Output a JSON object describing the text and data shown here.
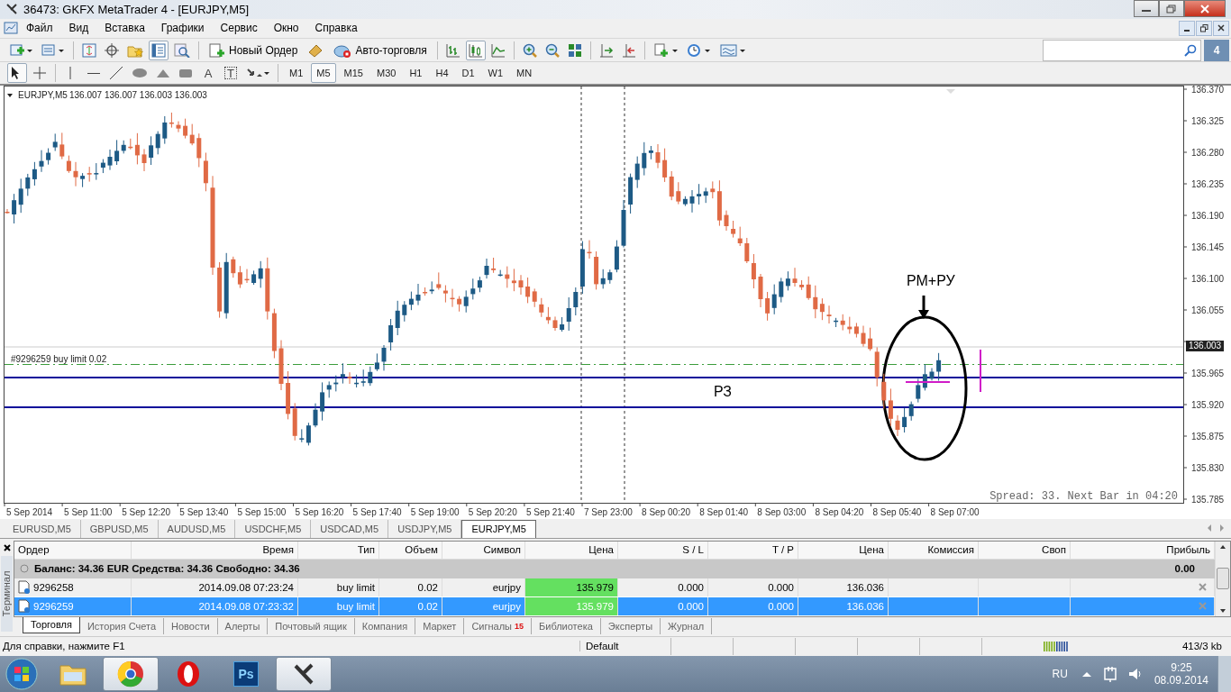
{
  "window": {
    "title": "36473: GKFX MetaTrader 4 - [EURJPY,M5]"
  },
  "menu": [
    "Файл",
    "Вид",
    "Вставка",
    "Графики",
    "Сервис",
    "Окно",
    "Справка"
  ],
  "toolbar": {
    "new_order": "Новый Ордер",
    "auto_trading": "Авто-торговля",
    "chart_types": [
      {
        "selected": false
      },
      {
        "selected": true
      },
      {
        "selected": false
      }
    ],
    "messages_badge": "4"
  },
  "drawing_tools": {
    "text_tool": "A",
    "label_tool": "T"
  },
  "timeframes": [
    {
      "label": "M1",
      "selected": false
    },
    {
      "label": "M5",
      "selected": true
    },
    {
      "label": "M15",
      "selected": false
    },
    {
      "label": "M30",
      "selected": false
    },
    {
      "label": "H1",
      "selected": false
    },
    {
      "label": "H4",
      "selected": false
    },
    {
      "label": "D1",
      "selected": false
    },
    {
      "label": "W1",
      "selected": false
    },
    {
      "label": "MN",
      "selected": false
    }
  ],
  "chart": {
    "symbol": "EURJPY,M5",
    "ohlc": "136.007 136.007 136.003 136.003",
    "price_ticks": [
      "136.370",
      "136.325",
      "136.280",
      "136.235",
      "136.190",
      "136.145",
      "136.100",
      "136.055",
      "135.965",
      "135.920",
      "135.875",
      "135.830",
      "135.785"
    ],
    "current_price": "136.003",
    "time_labels": [
      "5 Sep 2014",
      "5 Sep 11:00",
      "5 Sep 12:20",
      "5 Sep 13:40",
      "5 Sep 15:00",
      "5 Sep 16:20",
      "5 Sep 17:40",
      "5 Sep 19:00",
      "5 Sep 20:20",
      "5 Sep 21:40",
      "7 Sep 23:00",
      "8 Sep 00:20",
      "8 Sep 01:40",
      "8 Sep 03:00",
      "8 Sep 04:20",
      "8 Sep 05:40",
      "8 Sep 07:00"
    ],
    "order_label": "#9296259 buy limit 0.02",
    "annotations": [
      {
        "text": "РМ+РУ"
      },
      {
        "text": "РЗ"
      }
    ],
    "spread": "Spread: 33. Next Bar in 04:20"
  },
  "chart_tabs": [
    {
      "label": "EURUSD,M5",
      "selected": false
    },
    {
      "label": "GBPUSD,M5",
      "selected": false
    },
    {
      "label": "AUDUSD,M5",
      "selected": false
    },
    {
      "label": "USDCHF,M5",
      "selected": false
    },
    {
      "label": "USDCAD,M5",
      "selected": false
    },
    {
      "label": "USDJPY,M5",
      "selected": false
    },
    {
      "label": "EURJPY,M5",
      "selected": true
    }
  ],
  "terminal": {
    "side_label": "Терминал",
    "columns": [
      "Ордер",
      "Время",
      "Тип",
      "Объем",
      "Символ",
      "Цена",
      "S / L",
      "T / P",
      "Цена",
      "Комиссия",
      "Своп",
      "Прибыль"
    ],
    "balance": "Баланс: 34.36 EUR  Средства: 34.36  Свободно: 34.36",
    "balance_profit": "0.00",
    "rows": [
      {
        "order": "9296258",
        "time": "2014.09.08 07:23:24",
        "type": "buy limit",
        "volume": "0.02",
        "symbol": "eurjpy",
        "price": "135.979",
        "sl": "0.000",
        "tp": "0.000",
        "current": "136.036",
        "selected": false
      },
      {
        "order": "9296259",
        "time": "2014.09.08 07:23:32",
        "type": "buy limit",
        "volume": "0.02",
        "symbol": "eurjpy",
        "price": "135.979",
        "sl": "0.000",
        "tp": "0.000",
        "current": "136.036",
        "selected": true
      }
    ],
    "tabs": [
      {
        "label": "Торговля",
        "selected": true
      },
      {
        "label": "История Счета",
        "selected": false
      },
      {
        "label": "Новости",
        "selected": false
      },
      {
        "label": "Алерты",
        "selected": false
      },
      {
        "label": "Почтовый ящик",
        "selected": false
      },
      {
        "label": "Компания",
        "selected": false
      },
      {
        "label": "Маркет",
        "selected": false
      },
      {
        "label": "Сигналы",
        "selected": false,
        "badge": "15"
      },
      {
        "label": "Библиотека",
        "selected": false
      },
      {
        "label": "Эксперты",
        "selected": false
      },
      {
        "label": "Журнал",
        "selected": false
      }
    ]
  },
  "status_bar": {
    "help": "Для справки, нажмите F1",
    "profile": "Default",
    "traffic": "413/3 kb"
  },
  "taskbar": {
    "apps": [
      {
        "kind": "folder",
        "running": false
      },
      {
        "kind": "chrome",
        "running": true
      },
      {
        "kind": "opera",
        "running": false
      },
      {
        "kind": "photoshop",
        "label": "Ps",
        "running": false
      },
      {
        "kind": "metatrader",
        "running": true
      }
    ],
    "language": "RU",
    "time": "9:25",
    "date": "08.09.2014"
  }
}
